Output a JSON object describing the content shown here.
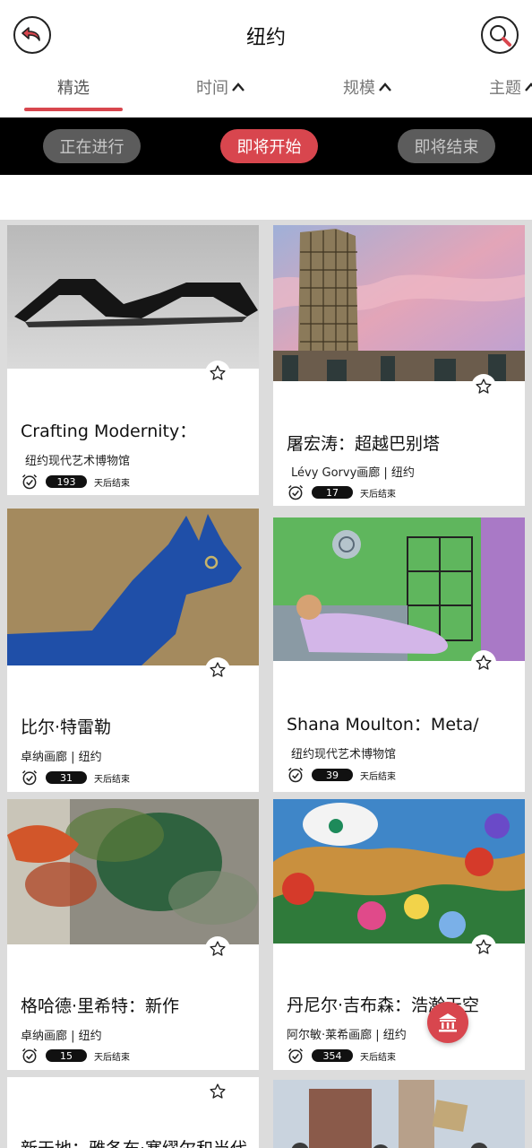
{
  "header": {
    "title": "纽约"
  },
  "tabs": [
    {
      "label": "精选"
    },
    {
      "label": "时间"
    },
    {
      "label": "规模"
    },
    {
      "label": "主题"
    }
  ],
  "filters": [
    {
      "label": "正在进行"
    },
    {
      "label": "即将开始"
    },
    {
      "label": "即将结束"
    }
  ],
  "days_suffix": "天后结束",
  "cards": [
    {
      "title": "Crafting Modernity：",
      "venue": "纽约现代艺术博物馆",
      "days": "193"
    },
    {
      "title": "屠宏涛：超越巴别塔",
      "venue": "Lévy Gorvy画廊 | 纽约",
      "days": "17"
    },
    {
      "title": "比尔·特雷勒",
      "venue": "卓纳画廊 | 纽约",
      "days": "31"
    },
    {
      "title": "Shana Moulton：Meta/",
      "venue": "纽约现代艺术博物馆",
      "days": "39"
    },
    {
      "title": "格哈德·里希特：新作",
      "venue": "卓纳画廊 | 纽约",
      "days": "15"
    },
    {
      "title": "丹尼尔·吉布森：浩瀚天空",
      "venue": "阿尔敏·莱希画廊 | 纽约",
      "days": "354"
    },
    {
      "title": "新天地：雅各布·塞缪尔和当代",
      "venue": "",
      "days": ""
    }
  ],
  "colors": {
    "accent": "#d8464e",
    "filterbar": "#000000",
    "pill_inactive": "#5c5c5c"
  },
  "icons": [
    "back-arrow-icon",
    "search-icon",
    "chevron-up-icon",
    "star-icon",
    "alarm-clock-icon",
    "museum-icon"
  ]
}
